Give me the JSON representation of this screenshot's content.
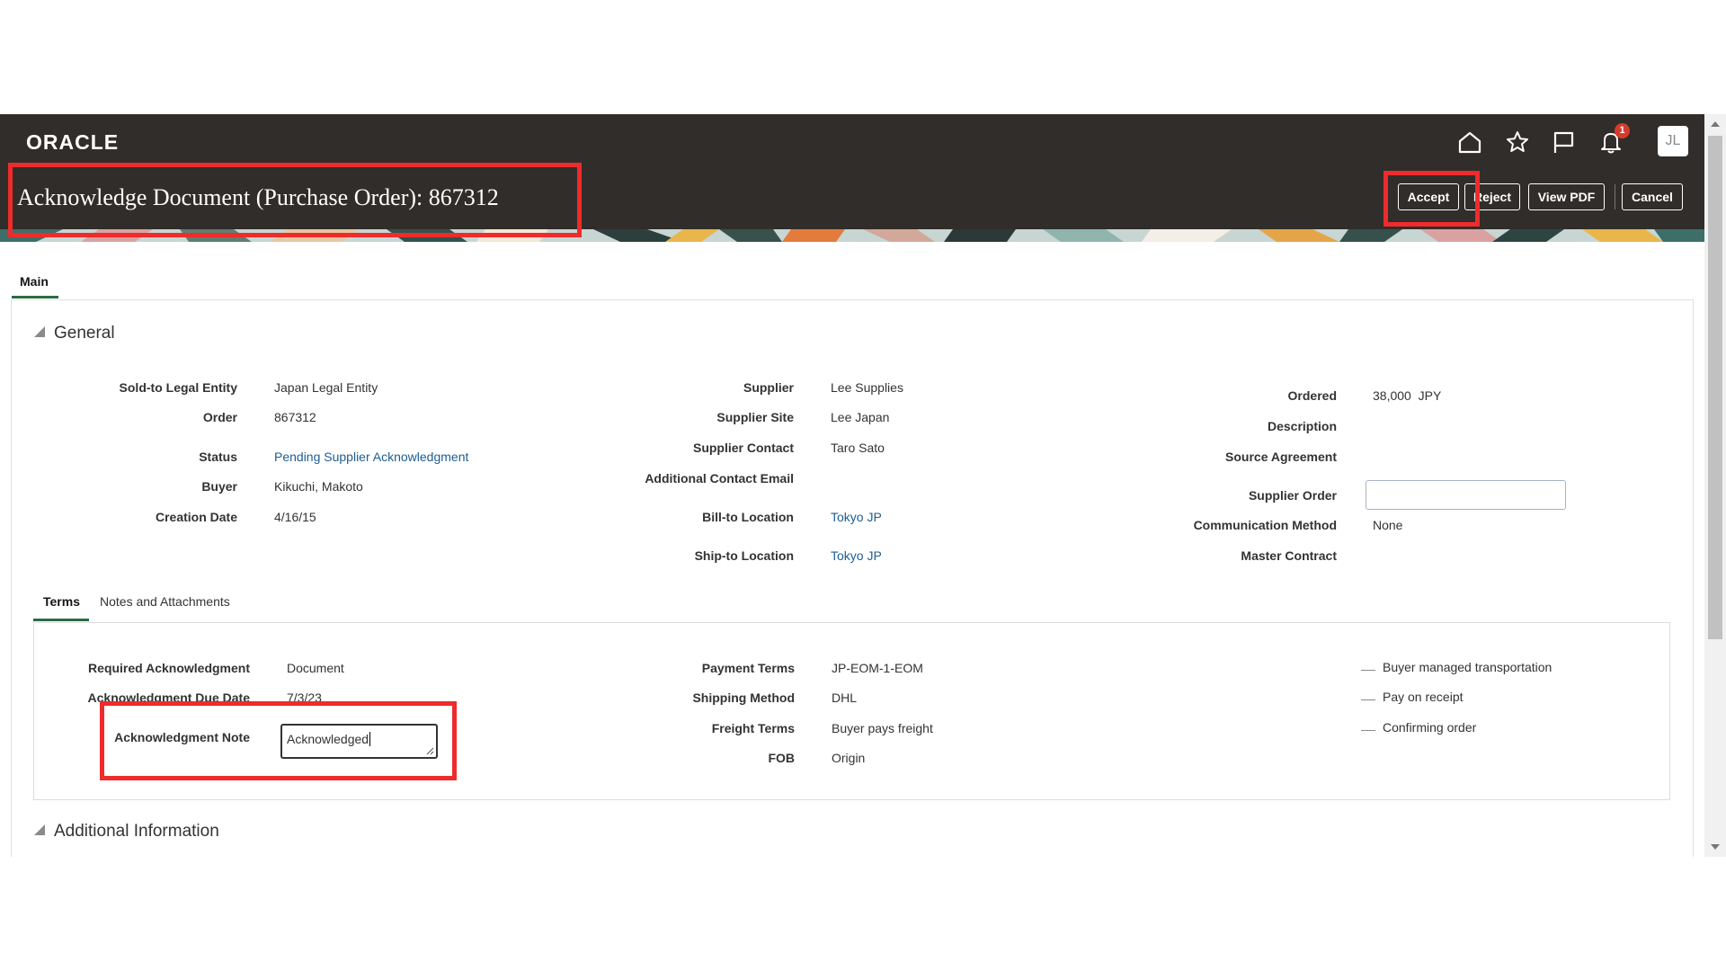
{
  "header": {
    "logo": "ORACLE",
    "title": "Acknowledge Document (Purchase Order): 867312",
    "notification_count": "1",
    "avatar_initials": "JL",
    "buttons": {
      "accept": "Accept",
      "reject": "Reject",
      "view_pdf": "View PDF",
      "cancel": "Cancel"
    }
  },
  "tabs": {
    "main": "Main"
  },
  "general": {
    "title": "General",
    "col1": {
      "sold_to_label": "Sold-to Legal Entity",
      "sold_to_value": "Japan Legal Entity",
      "order_label": "Order",
      "order_value": "867312",
      "status_label": "Status",
      "status_value": "Pending Supplier Acknowledgment",
      "buyer_label": "Buyer",
      "buyer_value": "Kikuchi, Makoto",
      "creation_label": "Creation Date",
      "creation_value": "4/16/15"
    },
    "col2": {
      "supplier_label": "Supplier",
      "supplier_value": "Lee Supplies",
      "site_label": "Supplier Site",
      "site_value": "Lee Japan",
      "contact_label": "Supplier Contact",
      "contact_value": "Taro Sato",
      "email_label": "Additional Contact Email",
      "bill_label": "Bill-to Location",
      "bill_value": "Tokyo JP",
      "ship_label": "Ship-to Location",
      "ship_value": "Tokyo JP"
    },
    "col3": {
      "ordered_label": "Ordered",
      "ordered_value": "38,000  JPY",
      "description_label": "Description",
      "source_label": "Source Agreement",
      "supplier_order_label": "Supplier Order",
      "supplier_order_value": "",
      "comm_label": "Communication Method",
      "comm_value": "None",
      "master_label": "Master Contract"
    }
  },
  "subtabs": {
    "terms": "Terms",
    "notes": "Notes and Attachments"
  },
  "terms": {
    "req_ack_label": "Required Acknowledgment",
    "req_ack_value": "Document",
    "due_label": "Acknowledgment Due Date",
    "due_value": "7/3/23",
    "note_label": "Acknowledgment Note",
    "note_value": "Acknowledged",
    "payment_label": "Payment Terms",
    "payment_value": "JP-EOM-1-EOM",
    "shipping_label": "Shipping Method",
    "shipping_value": "DHL",
    "freight_label": "Freight Terms",
    "freight_value": "Buyer pays freight",
    "fob_label": "FOB",
    "fob_value": "Origin",
    "check1": "Buyer managed transportation",
    "check2": "Pay on receipt",
    "check3": "Confirming order"
  },
  "additional": {
    "title": "Additional Information"
  },
  "colors": {
    "header_bg": "#312d2a",
    "link": "#1d5d90",
    "highlight": "#ef2b2b",
    "tab_underline": "#2d6a47"
  }
}
